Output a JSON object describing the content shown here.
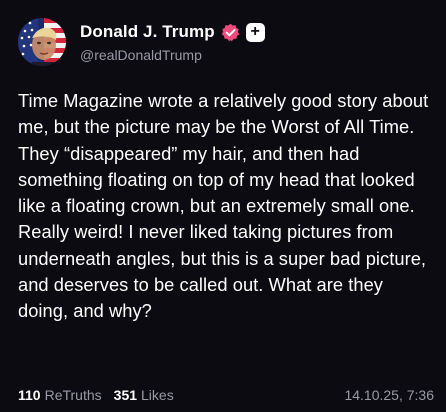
{
  "post": {
    "author": {
      "display_name": "Donald J. Trump",
      "handle": "@realDonaldTrump",
      "verified_icon": "verified-badge-icon",
      "follow_icon": "plus-icon",
      "follow_label": "+",
      "badge_color": "#ef4b7e"
    },
    "text": "Time Magazine wrote a relatively good story about me, but the picture may be the Worst of All Time. They “disappeared” my hair, and then had something floating on top of my head that looked like a floating crown, but an extremely small one. Really weird! I never liked taking pictures from underneath angles, but this is a super bad picture, and deserves to be called out. What are they doing, and why?",
    "stats": {
      "retruths_count": "110",
      "retruths_label": "ReTruths",
      "likes_count": "351",
      "likes_label": "Likes"
    },
    "timestamp": "14.10.25, 7:36"
  },
  "colors": {
    "background": "#0b0b11",
    "text": "#ffffff",
    "muted": "#9a9aa6",
    "accent": "#ef4b7e"
  }
}
